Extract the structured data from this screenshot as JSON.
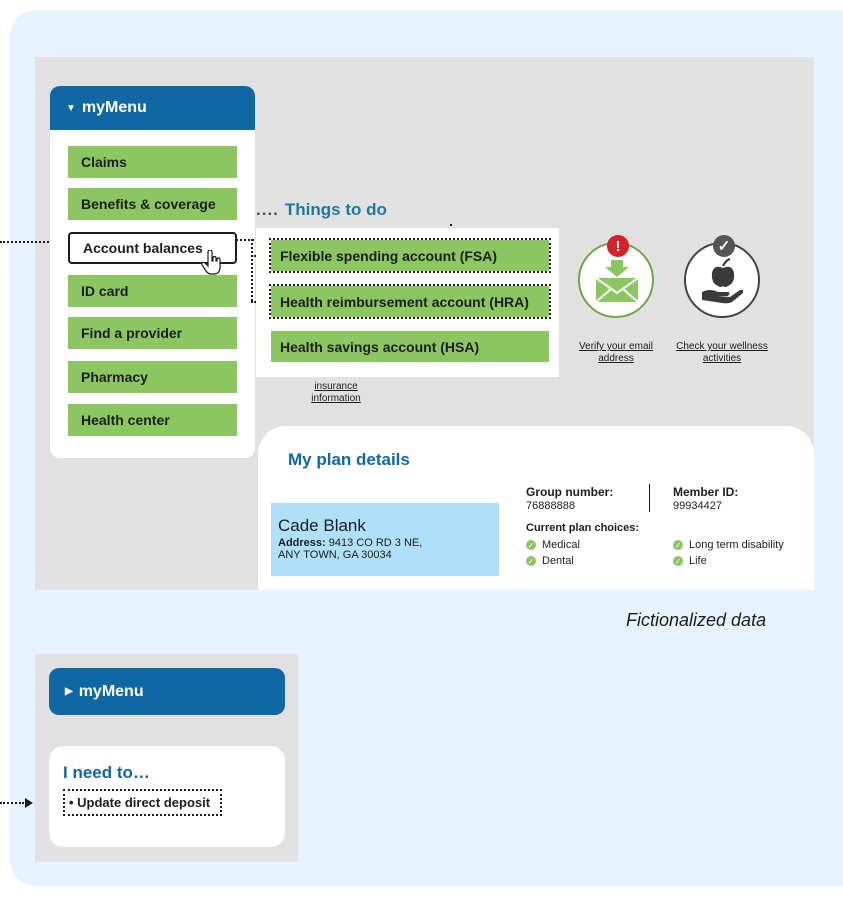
{
  "menu": {
    "title": "myMenu",
    "toggle_icon": "caret-down-icon",
    "items": [
      {
        "label": "Claims"
      },
      {
        "label": "Benefits & coverage"
      },
      {
        "label": "Account balances"
      },
      {
        "label": "ID card"
      },
      {
        "label": "Find a provider"
      },
      {
        "label": "Pharmacy"
      },
      {
        "label": "Health center"
      }
    ],
    "selected_item": "Account balances"
  },
  "things_to_do": {
    "title": "Things to do",
    "tasks": [
      {
        "label": "Flexible spending account (FSA)"
      },
      {
        "label": "Health reimbursement account (HRA)"
      },
      {
        "label": "Health savings account (HSA)"
      }
    ],
    "insurance_link": "insurance information",
    "actions": [
      {
        "label": "Verify your email address",
        "icon": "envelope-icon",
        "badge": "alert-icon",
        "badge_text": "!"
      },
      {
        "label": "Check your wellness activities",
        "icon": "apple-hand-icon",
        "badge": "check-icon",
        "badge_text": "✓"
      }
    ]
  },
  "plan": {
    "title": "My plan details",
    "member_name": "Cade Blank",
    "address_label": "Address:",
    "address_line1": "9413 CO RD 3 NE,",
    "address_line2": "ANY TOWN, GA  30034",
    "group_label": "Group number:",
    "group_value": "76888888",
    "member_id_label": "Member ID:",
    "member_id_value": "99934427",
    "choices_label": "Current plan choices:",
    "choices": [
      "Medical",
      "Dental",
      "Long term disability",
      "Life"
    ]
  },
  "note": "Fictionalized data",
  "menu2": {
    "title": "myMenu",
    "toggle_icon": "caret-right-icon",
    "need_title": "I need to…",
    "need_item": "• Update direct deposit"
  },
  "colors": {
    "blue": "#0f68a4",
    "green": "#8bc660",
    "teal": "#1c7b9b",
    "light_blue": "#aee0f8",
    "alert_red": "#d6202a"
  }
}
